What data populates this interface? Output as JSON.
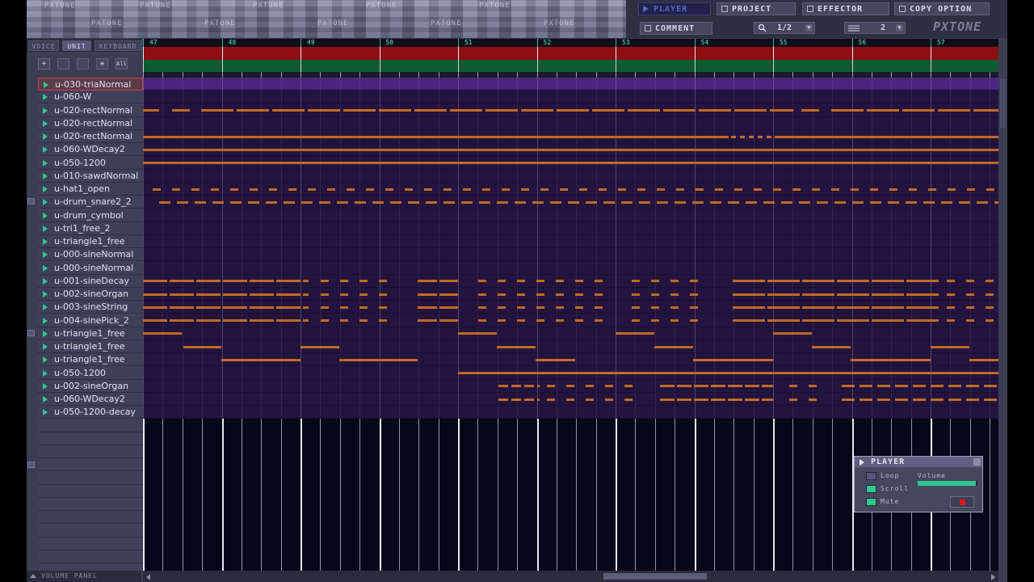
{
  "app": {
    "brand": "PXTONE"
  },
  "toolbar": {
    "player": "PLAYER",
    "project": "PROJECT",
    "effector": "EFFECTOR",
    "copy_option": "COPY OPTION",
    "comment": "COMMENT",
    "zoom_value": "1/2",
    "division_value": "2"
  },
  "tabs": [
    "VOICE",
    "UNIT",
    "KEYBOARD"
  ],
  "active_tab": "UNIT",
  "measures": [
    "47",
    "48",
    "49",
    "50",
    "51",
    "52",
    "53",
    "54",
    "55",
    "56",
    "57"
  ],
  "units": [
    "u-030-triaNormal",
    "u-060-W",
    "u-020-rectNormal",
    "u-020-rectNormal",
    "u-020-rectNormal",
    "u-060-WDecay2",
    "u-050-1200",
    "u-010-sawdNormal",
    "u-hat1_open",
    "u-drum_snare2_2",
    "u-drum_cymbol",
    "u-tri1_free_2",
    "u-triangle1_free",
    "u-000-sineNormal",
    "u-000-sineNormal",
    "u-001-sineDecay",
    "u-002-sineOrgan",
    "u-003-sineString",
    "u-004-sinePick_2",
    "u-triangle1_free",
    "u-triangle1_free",
    "u-triangle1_free",
    "u-050-1200",
    "u-002-sineOrgan",
    "u-060-WDecay2",
    "u-050-1200-decay"
  ],
  "selected_unit_index": 0,
  "player": {
    "title": "PLAYER",
    "loop_label": "Loop",
    "scroll_label": "Scroll",
    "mute_label": "Mute",
    "volume_label": "Volume",
    "loop": false,
    "scroll": true,
    "mute": true,
    "volume": 0.97
  },
  "volume_panel_label": "VOLUME PANEL",
  "colors": {
    "note": "#c26a22",
    "accent_green": "#2fc890",
    "measure_teal": "#3fb2a4",
    "lane_bg": "#23133f",
    "selected_lane": "#4a2480"
  }
}
